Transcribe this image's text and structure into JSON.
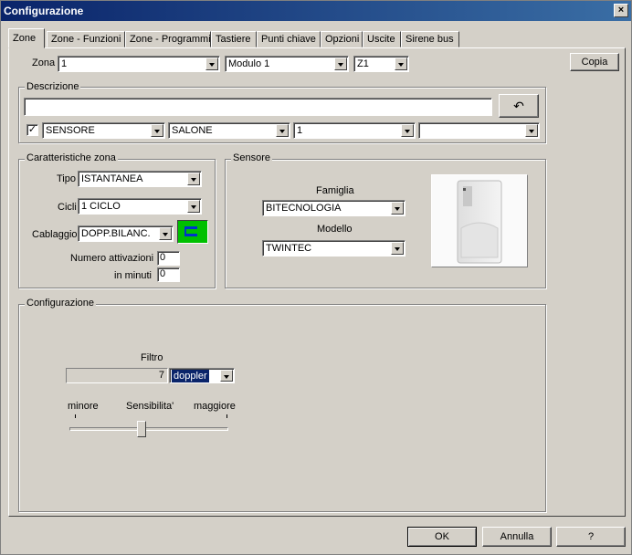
{
  "window": {
    "title": "Configurazione",
    "close_label": "×"
  },
  "tabs": [
    "Zone",
    "Zone - Funzioni",
    "Zone - Programmi",
    "Tastiere",
    "Punti chiave",
    "Opzioni",
    "Uscite",
    "Sirene bus"
  ],
  "active_tab": "Zone",
  "top_row": {
    "zona_label": "Zona",
    "zona_value": "1",
    "modulo_value": "Modulo 1",
    "z_value": "Z1",
    "copia_label": "Copia"
  },
  "descrizione": {
    "title": "Descrizione",
    "text_value": "",
    "undo_icon": "undo-arrow-icon",
    "checked": true,
    "combos": [
      "SENSORE",
      "SALONE",
      "1",
      ""
    ]
  },
  "caratteristiche": {
    "title": "Caratteristiche zona",
    "tipo_label": "Tipo",
    "tipo_value": "ISTANTANEA",
    "cicli_label": "Cicli",
    "cicli_value": "1  CICLO",
    "cablaggio_label": "Cablaggio",
    "cablaggio_value": "DOPP.BILANC.",
    "cablaggio_icon_color": "#00c000",
    "num_attivazioni_label": "Numero attivazioni",
    "num_attivazioni_value": "0",
    "in_minuti_label": "in minuti",
    "in_minuti_value": "0"
  },
  "sensore": {
    "title": "Sensore",
    "famiglia_label": "Famiglia",
    "famiglia_value": "BITECNOLOGIA",
    "modello_label": "Modello",
    "modello_value": "TWINTEC"
  },
  "configurazione": {
    "title": "Configurazione",
    "filtro_label": "Filtro",
    "filtro_value": "7",
    "filtro_mode": "doppler",
    "min_label": "minore",
    "sens_label": "Sensibilita'",
    "max_label": "maggiore",
    "sensitivity_level": 0.45
  },
  "footer": {
    "ok_label": "OK",
    "annulla_label": "Annulla",
    "help_label": "?"
  },
  "colors": {
    "title_bar": "#0a246a",
    "face": "#d4d0c8",
    "selection": "#0a246a"
  }
}
